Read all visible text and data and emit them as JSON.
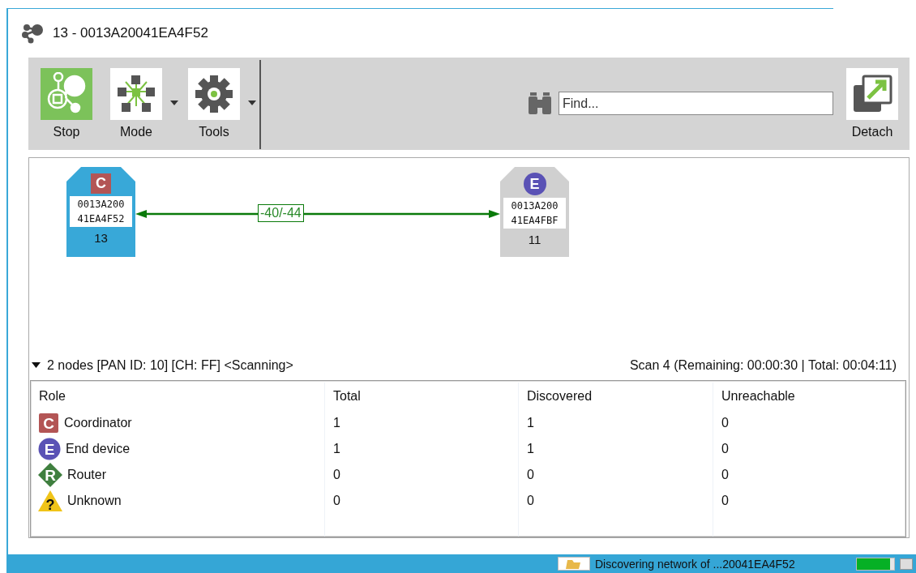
{
  "window": {
    "title": "13 - 0013A20041EA4F52"
  },
  "toolbar": {
    "buttons": [
      {
        "label": "Stop",
        "kind": "stop",
        "dropdown": false
      },
      {
        "label": "Mode",
        "kind": "mode",
        "dropdown": true
      },
      {
        "label": "Tools",
        "kind": "tools",
        "dropdown": true
      }
    ],
    "search": {
      "placeholder": "Find..."
    },
    "detach": {
      "label": "Detach"
    }
  },
  "graph": {
    "nodes": [
      {
        "kind": "coordinator",
        "badge": "C",
        "address": [
          "0013A200",
          "41EA4F52"
        ],
        "id": "13",
        "selected": true
      },
      {
        "kind": "end_device",
        "badge": "E",
        "address": [
          "0013A200",
          "41EA4FBF"
        ],
        "id": "11",
        "selected": false
      }
    ],
    "link": {
      "label": "-40/-44"
    }
  },
  "summary": {
    "expanded": true,
    "text": "2 nodes [PAN ID: 10] [CH: FF] <Scanning>",
    "scan": "Scan 4 (Remaining: 00:00:30 | Total: 00:04:11)"
  },
  "table": {
    "columns": [
      "Role",
      "Total",
      "Discovered",
      "Unreachable"
    ],
    "rows": [
      {
        "kind": "coordinator",
        "badge": "C",
        "cells": [
          "Coordinator",
          "1",
          "1",
          "0"
        ]
      },
      {
        "kind": "end_device",
        "badge": "E",
        "cells": [
          "End device",
          "1",
          "1",
          "0"
        ]
      },
      {
        "kind": "router",
        "badge": "R",
        "cells": [
          "Router",
          "0",
          "0",
          "0"
        ]
      },
      {
        "kind": "unknown",
        "badge": "?",
        "cells": [
          "Unknown",
          "0",
          "0",
          "0"
        ]
      }
    ]
  },
  "status_bar": {
    "message": "Discovering network of ...20041EA4F52",
    "progress": {
      "level": 0.9
    }
  }
}
